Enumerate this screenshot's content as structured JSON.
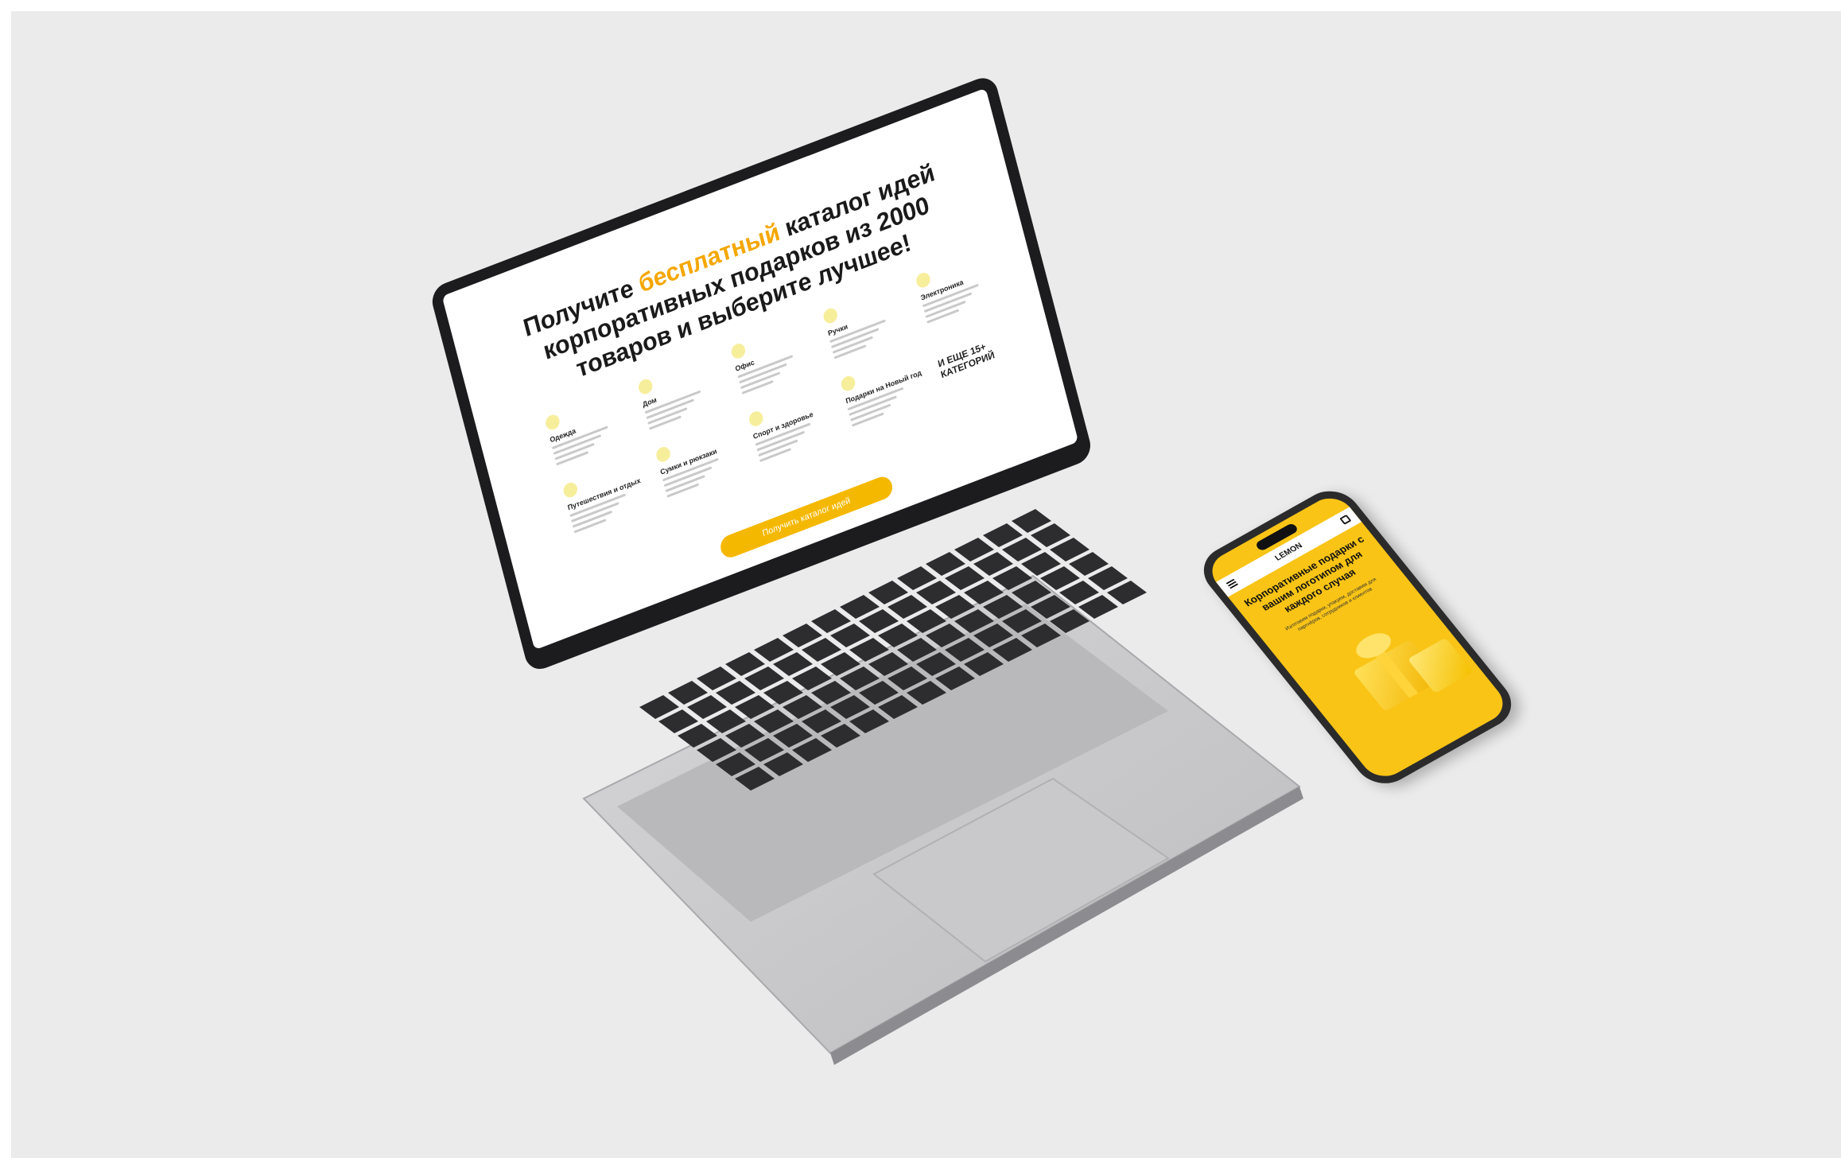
{
  "laptop": {
    "headline_pre": "Получите ",
    "headline_highlight": "бесплатный",
    "headline_post": " каталог идей корпоративных подарков из 2000 товаров и выберите лучшее!",
    "categories": [
      {
        "title": "Одежда"
      },
      {
        "title": "Дом"
      },
      {
        "title": "Офис"
      },
      {
        "title": "Ручки"
      },
      {
        "title": "Электроника"
      },
      {
        "title": "Путешествия и отдых"
      },
      {
        "title": "Сумки и рюкзаки"
      },
      {
        "title": "Спорт и здоровье"
      },
      {
        "title": "Подарки на Новый год"
      },
      {
        "title": ""
      }
    ],
    "more_categories": "И ЕЩЕ 15+ КАТЕГОРИЙ",
    "cta_label": "Получить каталог идей"
  },
  "phone": {
    "brand": "LEMON",
    "title": "Корпоративные подарки с вашим логотипом для каждого случая",
    "subtitle": "Изготовим подарки, упакуем, доставим для партнёров, сотрудников и клиентов"
  },
  "colors": {
    "background": "#ebebeb",
    "accent": "#f5b800",
    "highlight": "#f5a700",
    "laptop_body": "#cfcfd1",
    "screen_bezel": "#1c1c1e"
  }
}
